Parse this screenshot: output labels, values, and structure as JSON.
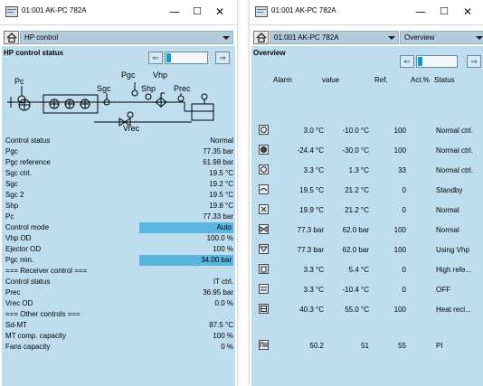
{
  "win1": {
    "title": "01:001 AK-PC 782A",
    "controls": {
      "minimize": "—",
      "maximize": "☐",
      "close": "✕"
    },
    "nav": {
      "selected": "HP control"
    },
    "header": "HP control status",
    "schematic": {
      "pc": "Pc",
      "sgc": "Sgc",
      "pgc": "Pgc",
      "vhp": "Vhp",
      "shp": "Shp",
      "prec": "Prec",
      "vrec": "Vrec"
    },
    "rows": [
      {
        "label": "Control status",
        "value": "Normal"
      },
      {
        "label": "Pgc",
        "value": "77.35 bar"
      },
      {
        "label": "Pgc reference",
        "value": "61.98 bar"
      },
      {
        "label": "Sgc ctrl.",
        "value": "19.5 °C"
      },
      {
        "label": "Sgc",
        "value": "19.2 °C"
      },
      {
        "label": "Sgc 2",
        "value": "19.5 °C"
      },
      {
        "label": "Shp",
        "value": "19.8 °C"
      },
      {
        "label": "Pc",
        "value": "77.33 bar"
      },
      {
        "label": "Control mode",
        "value": "Auto"
      },
      {
        "label": "Vhp OD",
        "value": "100.0 %"
      },
      {
        "label": "Ejector OD",
        "value": "100 %"
      },
      {
        "label": "Pgc min.",
        "value": "34.00 bar"
      },
      {
        "label": "=== Receiver control ===",
        "value": ""
      },
      {
        "label": "Control status",
        "value": "IT ctrl."
      },
      {
        "label": "Prec",
        "value": "36.95 bar"
      },
      {
        "label": "Vrec OD",
        "value": "0.0 %"
      },
      {
        "label": "=== Other controls ===",
        "value": ""
      },
      {
        "label": "Sd-MT",
        "value": "87.5 °C"
      },
      {
        "label": "MT comp. capacity",
        "value": "100 %"
      },
      {
        "label": "Fans capacity",
        "value": "0 %"
      }
    ]
  },
  "win2": {
    "title": "01:001 AK-PC 782A",
    "controls": {
      "minimize": "—",
      "maximize": "☐",
      "close": "✕"
    },
    "nav": {
      "controller": "01:001 AK-PC 782A",
      "view": "Overview"
    },
    "header": "Overview",
    "columns": {
      "alarm": "Alarm",
      "value": "value",
      "ref": "Ref.",
      "act": "Act.%",
      "status": "Status"
    },
    "rows": [
      {
        "icon": "compressor-icon",
        "value": "3.0 °C",
        "ref": "-10.0 °C",
        "act": "100",
        "status": "Normal ctrl."
      },
      {
        "icon": "compressor-icon",
        "value": "-24.4 °C",
        "ref": "-30.0 °C",
        "act": "100",
        "status": "Normal ctrl."
      },
      {
        "icon": "compressor-icon",
        "value": "3.3 °C",
        "ref": "1.3 °C",
        "act": "33",
        "status": "Normal ctrl."
      },
      {
        "icon": "gas-cooler-icon",
        "value": "19.5 °C",
        "ref": "21.2 °C",
        "act": "0",
        "status": "Standby"
      },
      {
        "icon": "fan-icon",
        "value": "19.9 °C",
        "ref": "21.2 °C",
        "act": "0",
        "status": "Normal"
      },
      {
        "icon": "hp-valve-icon",
        "value": "77.3 bar",
        "ref": "62.0 bar",
        "act": "100",
        "status": "Normal"
      },
      {
        "icon": "ejector-icon",
        "value": "77.3 bar",
        "ref": "62.0 bar",
        "act": "100",
        "status": "Using Vhp"
      },
      {
        "icon": "receiver-icon",
        "value": "3.3 °C",
        "ref": "5.4 °C",
        "act": "0",
        "status": "High refe..."
      },
      {
        "icon": "heat-exchanger-icon",
        "value": "3.3 °C",
        "ref": "-10.4 °C",
        "act": "0",
        "status": "OFF"
      },
      {
        "icon": "heat-recovery-icon",
        "value": "40.3 °C",
        "ref": "55.0 °C",
        "act": "100",
        "status": "Heat recl..."
      },
      {
        "icon": "pi-controller-icon",
        "value": "50.2",
        "ref": "51",
        "act": "55",
        "status": "PI"
      }
    ]
  },
  "colors": {
    "panel": "#bedeef",
    "highlight": "#5bb6df",
    "dropdown": "#b3ccdc"
  }
}
